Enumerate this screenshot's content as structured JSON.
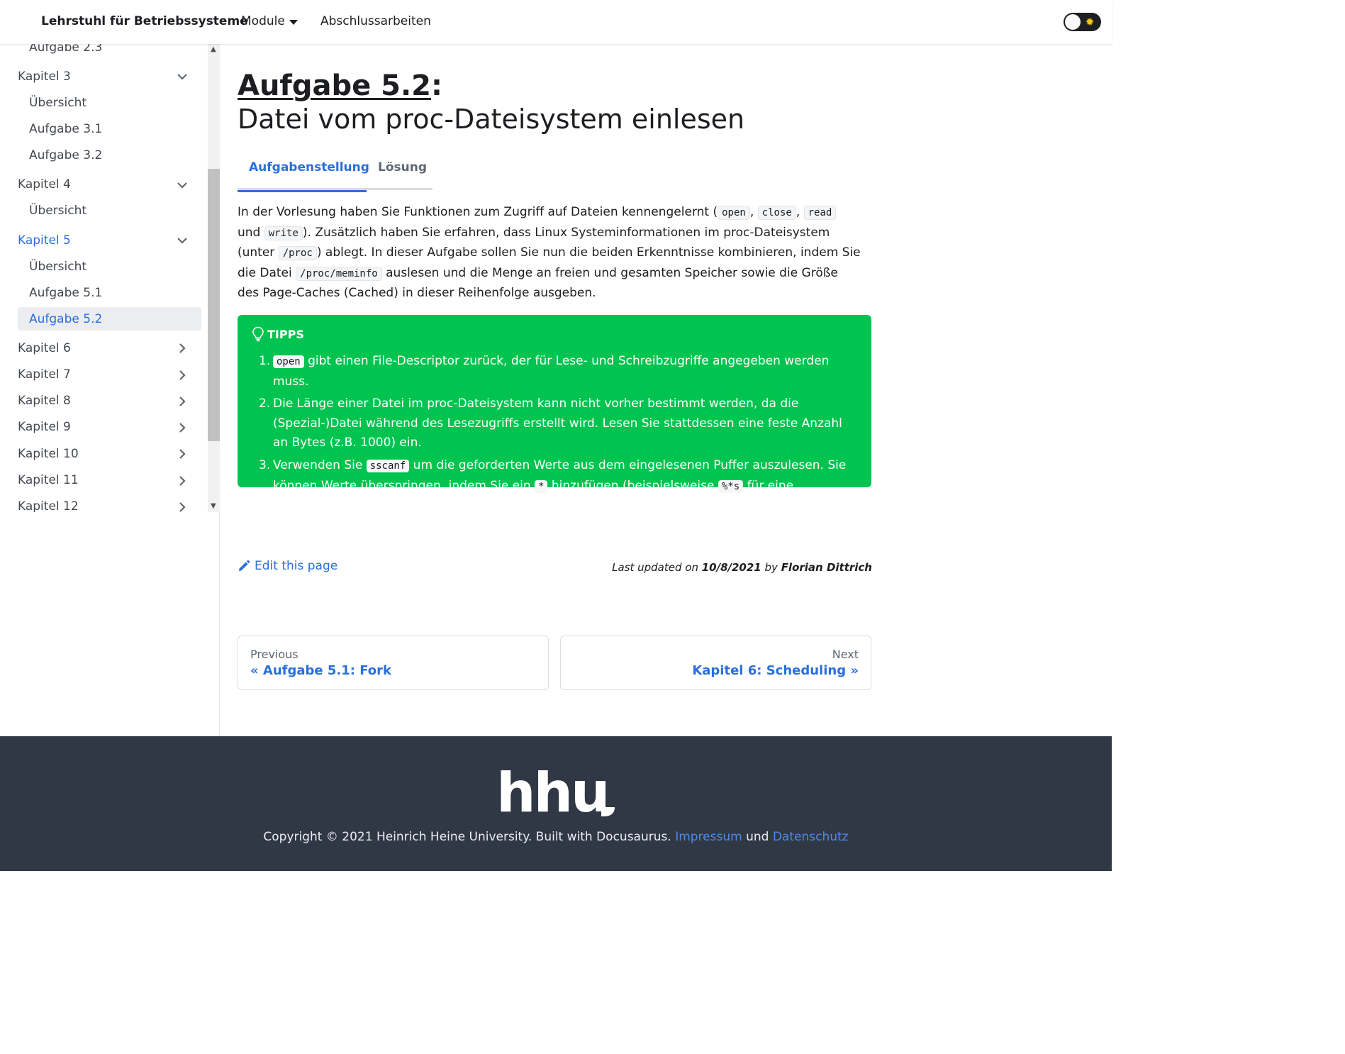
{
  "navbar": {
    "brand": "Lehrstuhl für Betriebssysteme",
    "modules_label": "Module",
    "abschluss_label": "Abschlussarbeiten"
  },
  "sidebar": {
    "items": [
      {
        "label": "Aufgabe 2.3"
      },
      {
        "label": "Kapitel 3"
      },
      {
        "label": "Übersicht"
      },
      {
        "label": "Aufgabe 3.1"
      },
      {
        "label": "Aufgabe 3.2"
      },
      {
        "label": "Kapitel 4"
      },
      {
        "label": "Übersicht"
      },
      {
        "label": "Kapitel 5"
      },
      {
        "label": "Übersicht"
      },
      {
        "label": "Aufgabe 5.1"
      },
      {
        "label": "Aufgabe 5.2"
      },
      {
        "label": "Kapitel 6"
      },
      {
        "label": "Kapitel 7"
      },
      {
        "label": "Kapitel 8"
      },
      {
        "label": "Kapitel 9"
      },
      {
        "label": "Kapitel 10"
      },
      {
        "label": "Kapitel 11"
      },
      {
        "label": "Kapitel 12"
      }
    ]
  },
  "main": {
    "title_link": "Aufgabe 5.2",
    "title_colon": ":",
    "subtitle": "Datei vom proc-Dateisystem einlesen",
    "tabs": [
      {
        "label": "Aufgabenstellung"
      },
      {
        "label": "Lösung"
      }
    ],
    "para": {
      "t1": "In der Vorlesung haben Sie Funktionen zum Zugriff auf Dateien kennengelernt (",
      "c_open": "open",
      "sep1": ", ",
      "c_close": "close",
      "sep2": ", ",
      "c_read": "read",
      "t2": " und ",
      "c_write": "write",
      "t3": "). Zusätzlich haben Sie erfahren, dass Linux Systeminformationen im proc-Dateisystem (unter ",
      "c_proc": "/proc",
      "t4": ") ablegt. In dieser Aufgabe sollen Sie nun die beiden Erkenntnisse kombinieren, indem Sie die Datei ",
      "c_meminfo": "/proc/meminfo",
      "t5": " auslesen und die Menge an freien und gesamten Speicher sowie die Größe des Page-Caches (Cached) in dieser Reihenfolge ausgeben."
    },
    "tipps": {
      "heading": "TIPPS",
      "tip1_num": "1.",
      "tip1_code": "open",
      "tip1_text": " gibt einen File-Descriptor zurück, der für Lese- und Schreibzugriffe angegeben werden muss.",
      "tip2_num": "2.",
      "tip2_text": "Die Länge einer Datei im proc-Dateisystem kann nicht vorher bestimmt werden, da die (Spezial-)Datei während des Lesezugriffs erstellt wird. Lesen Sie stattdessen eine feste Anzahl an Bytes (z.B. 1000) ein.",
      "tip3_num": "3.",
      "tip3_t1": "Verwenden Sie ",
      "tip3_c1": "sscanf",
      "tip3_t2": " um die geforderten Werte aus dem eingelesenen Puffer auszulesen. Sie können Werte überspringen, indem Sie ein ",
      "tip3_c2": "*",
      "tip3_t3": " hinzufügen (beispielsweise ",
      "tip3_c3": "%*s",
      "tip3_t4": " für eine Zeichenkette, die nicht gespeichert werden soll)."
    },
    "edit_label": "Edit this page",
    "updated": {
      "prefix": "Last updated on ",
      "date": "10/8/2021",
      "by": " by ",
      "author": "Florian Dittrich"
    },
    "pager": {
      "prev_sub": "Previous",
      "prev_label": "« Aufgabe 5.1: Fork",
      "next_sub": "Next",
      "next_label": "Kapitel 6: Scheduling »"
    }
  },
  "footer": {
    "logo_text": "hhu",
    "copyright": "Copyright © 2021 Heinrich Heine University. Built with Docusaurus. ",
    "impressum": "Impressum",
    "und": " und ",
    "datenschutz": "Datenschutz"
  },
  "colors": {
    "accent": "#2a6fdb",
    "tipps_bg": "#00c44f",
    "footer_bg": "#303846"
  }
}
